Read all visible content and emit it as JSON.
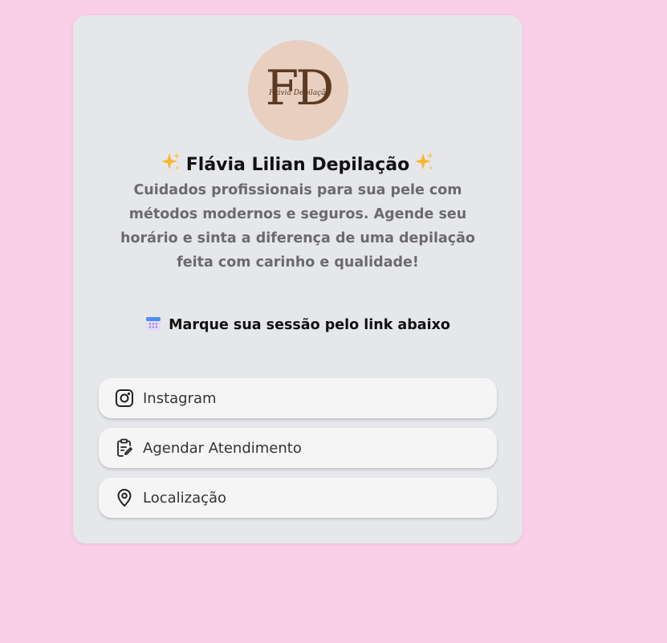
{
  "profile": {
    "logo_monogram": "FD",
    "logo_script": "Flávia Depilação",
    "title": "Flávia Lilian Depilação",
    "title_icon": "sparkles-icon",
    "description": "Cuidados profissionais para sua pele com métodos modernos e seguros. Agende seu horário e sinta a diferença de uma depilação feita com carinho e qualidade!"
  },
  "cta": {
    "icon": "calendar-icon",
    "text": "Marque sua sessão pelo link abaixo"
  },
  "links": [
    {
      "label": "Instagram",
      "icon": "instagram-icon"
    },
    {
      "label": "Agendar Atendimento",
      "icon": "clipboard-edit-icon"
    },
    {
      "label": "Localização",
      "icon": "map-pin-icon"
    }
  ],
  "colors": {
    "page_background": "#fccfe8",
    "card_background": "#e5e7eb",
    "logo_background": "#e8cfc0",
    "button_background": "#f5f5f5"
  }
}
